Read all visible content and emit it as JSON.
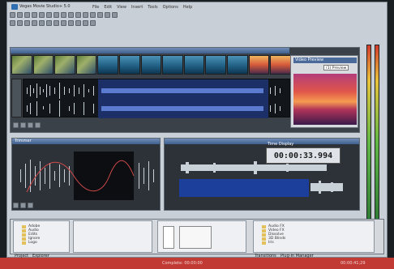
{
  "app": {
    "title": "Vegas Movie Studio+ 5.0"
  },
  "menu": [
    "File",
    "Edit",
    "View",
    "Insert",
    "Tools",
    "Options",
    "Help"
  ],
  "preview": {
    "title": "Video Preview",
    "preset": "(1) Preview"
  },
  "trimmer": {
    "title": "Trimmer"
  },
  "time_display": {
    "label": "Time Display",
    "value": "00:00:33.994"
  },
  "explorer": {
    "tab_left": "Project",
    "tab_right": "Explorer",
    "folders": [
      "Adobe",
      "Audio",
      "Edits",
      "Ignore",
      "Logo"
    ]
  },
  "plugin_manager": {
    "tab": "Transitions",
    "tab2": "Plug-In Manager",
    "items": [
      "Audio FX",
      "Video FX",
      "Dissolve",
      "3D Blinds",
      "Iris"
    ]
  },
  "status": {
    "left": "Complete: 00:00:00",
    "right": "00:00:41;29"
  },
  "colors": {
    "selection": "#1c2f66",
    "waveform": "#c8d0d8",
    "accent": "#c23a34"
  }
}
